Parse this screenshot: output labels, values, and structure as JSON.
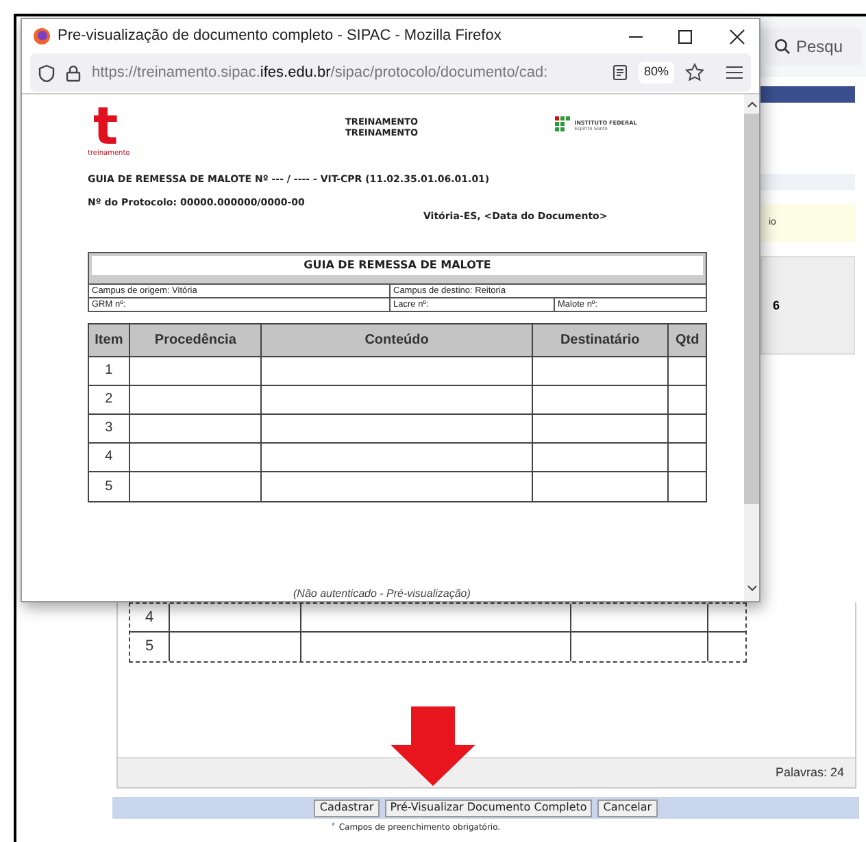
{
  "background": {
    "search_placeholder": "Pesqu",
    "fragments": [
      "io",
      "6"
    ],
    "table_rows": [
      {
        "item": "4"
      },
      {
        "item": "5"
      }
    ],
    "word_count": "Palavras: 24",
    "buttons": [
      "Cadastrar",
      "Pré-Visualizar Documento Completo",
      "Cancelar"
    ],
    "required_mark": "*",
    "required_note": "Campos de preenchimento obrigatório."
  },
  "popup": {
    "title": "Pre-visualização de documento completo - SIPAC - Mozilla Firefox",
    "url": "https://treinamento.sipac.**ifes.edu.br**/sipac/protocolo/documento/cad:",
    "zoom": "80%",
    "document": {
      "logo_letter": "t",
      "logo_caption": "treinamento",
      "header_lines": [
        "TREINAMENTO",
        "TREINAMENTO"
      ],
      "institute": {
        "name": "INSTITUTO FEDERAL",
        "subtitle": "Espírito Santo"
      },
      "guide_title": "GUIA DE REMESSA DE MALOTE Nº --- / ---- - VIT-CPR (11.02.35.01.06.01.01)",
      "protocol": "Nº do Protocolo: 00000.000000/0000-00",
      "place_date": "Vitória-ES, <Data do Documento>",
      "form_box": {
        "title": "GUIA DE REMESSA DE MALOTE",
        "origin": "Campus de origem: Vitória",
        "destination": "Campus de destino: Reitoria",
        "grm": "GRM nº:",
        "lacre": "Lacre nº:",
        "malote": "Malote nº:"
      },
      "items_table": {
        "columns": [
          "Item",
          "Procedência",
          "Conteúdo",
          "Destinatário",
          "Qtd"
        ],
        "rows": [
          {
            "item": "1"
          },
          {
            "item": "2"
          },
          {
            "item": "3"
          },
          {
            "item": "4"
          },
          {
            "item": "5"
          }
        ]
      },
      "footer": "(Não autenticado - Pré-visualização)"
    }
  }
}
